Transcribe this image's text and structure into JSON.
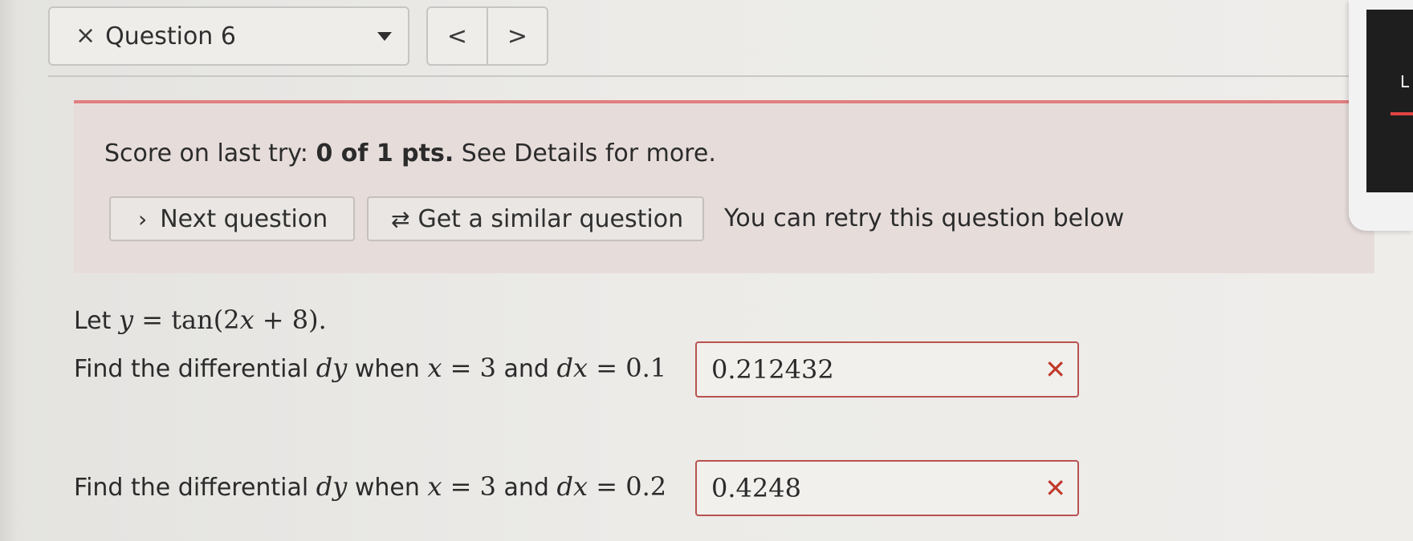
{
  "nav": {
    "close_glyph": "×",
    "question_label": "Question 6",
    "prev_glyph": "<",
    "next_glyph": ">"
  },
  "alert": {
    "score_prefix": "Score on last try: ",
    "score_value": "0 of 1 pts.",
    "score_suffix": " See Details for more.",
    "next_button": "Next question",
    "next_icon": "chevron-right-icon",
    "similar_button": "Get a similar question",
    "similar_icon": "refresh-icon",
    "retry_note": "You can retry this question below"
  },
  "question": {
    "intro_prefix": "Let ",
    "intro_y": "y",
    "intro_eq": " = tan(2",
    "intro_x": "x",
    "intro_tail": " + 8).",
    "parts": [
      {
        "prompt": "Find the differential ",
        "dy": "dy",
        "when": " when ",
        "x": "x",
        "eq_x": " = 3",
        "and": " and ",
        "dx": "dx",
        "eq_dx": " = 0.1",
        "answer": "0.212432",
        "status": "✕"
      },
      {
        "prompt": "Find the differential ",
        "dy": "dy",
        "when": " when ",
        "x": "x",
        "eq_x": " = 3",
        "and": " and ",
        "dx": "dx",
        "eq_dx": " = 0.2",
        "answer": "0.4248",
        "status": "✕"
      }
    ]
  },
  "device_edge_letter": "L",
  "colors": {
    "alert_border": "#e07f7f",
    "alert_bg": "#e6dddb",
    "wrong_mark": "#c0392b",
    "answer_border": "#b9524f"
  }
}
